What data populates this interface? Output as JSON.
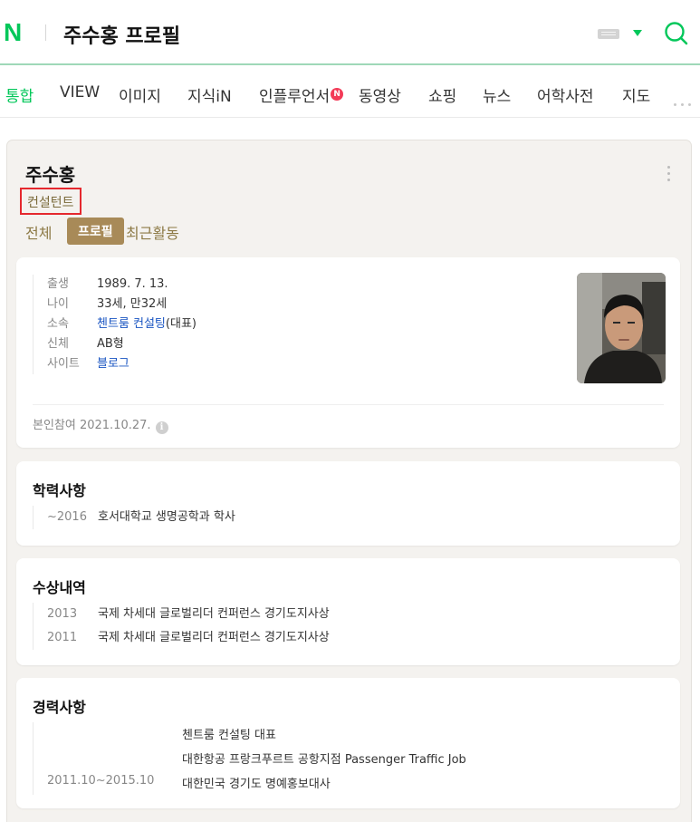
{
  "header": {
    "logo": "N",
    "query": "주수홍 프로필",
    "icons": [
      "keyboard-icon",
      "dropdown-caret-icon",
      "search-icon"
    ],
    "accent_color": "#03c75a"
  },
  "tabs": [
    {
      "label": "통합",
      "active": true
    },
    {
      "label": "VIEW"
    },
    {
      "label": "이미지"
    },
    {
      "label": "지식iN"
    },
    {
      "label": "인플루언서",
      "badge": "N"
    },
    {
      "label": "동영상"
    },
    {
      "label": "쇼핑"
    },
    {
      "label": "뉴스"
    },
    {
      "label": "어학사전"
    },
    {
      "label": "지도"
    }
  ],
  "profile": {
    "name": "주수홍",
    "occupation": "컨설턴트",
    "subtabs": [
      "전체",
      "프로필",
      "최근활동"
    ],
    "active_subtab": "프로필",
    "info": [
      {
        "label": "출생",
        "value": "1989. 7. 13."
      },
      {
        "label": "나이",
        "value": "33세, 만32세"
      },
      {
        "label": "소속",
        "link": "첸트룸 컨설팅",
        "value": "(대표)"
      },
      {
        "label": "신체",
        "value": "AB형"
      },
      {
        "label": "사이트",
        "link": "블로그"
      }
    ],
    "verified": "본인참여 2021.10.27.",
    "info_icon": "i"
  },
  "education": {
    "title": "학력사항",
    "items": [
      {
        "year": "~2016",
        "text": "호서대학교 생명공학과 학사"
      }
    ]
  },
  "awards": {
    "title": "수상내역",
    "items": [
      {
        "year": "2013",
        "text": "국제 차세대 글로벌리더 컨퍼런스 경기도지사상"
      },
      {
        "year": "2011",
        "text": "국제 차세대 글로벌리더 컨퍼런스 경기도지사상"
      }
    ]
  },
  "career": {
    "title": "경력사항",
    "items": [
      {
        "period": "",
        "text": "첸트룸 컨설팅 대표"
      },
      {
        "period": "",
        "text": "대한항공 프랑크푸르트 공항지점 Passenger Traffic Job"
      },
      {
        "period": "2011.10~2015.10",
        "text": "대한민국 경기도 명예홍보대사"
      }
    ]
  }
}
